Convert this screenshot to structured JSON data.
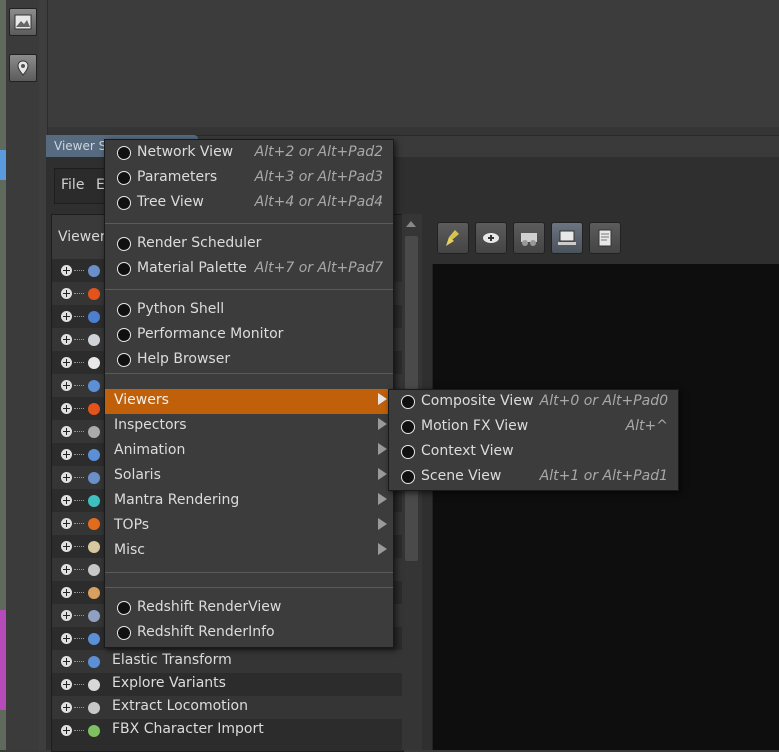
{
  "pane": {
    "tab_label": "Viewer St"
  },
  "menubar": {
    "file": "File",
    "edit": "E"
  },
  "tree": {
    "header": "Viewer",
    "items": [
      {
        "label": "",
        "icon": "toolbox-icon"
      },
      {
        "label": "",
        "icon": "houdini-swirl-icon"
      },
      {
        "label": "",
        "icon": "figure-icon"
      },
      {
        "label": "",
        "icon": "animals-icon"
      },
      {
        "label": "",
        "icon": "plane-icon"
      },
      {
        "label": "",
        "icon": "python-icon"
      },
      {
        "label": "",
        "icon": "houdini-swirl-icon"
      },
      {
        "label": "",
        "icon": "crowd-icon"
      },
      {
        "label": "",
        "icon": "python-icon"
      },
      {
        "label": "",
        "icon": "runner-icon"
      },
      {
        "label": "",
        "icon": "horseshoe-icon"
      },
      {
        "label": "",
        "icon": "explosion-icon"
      },
      {
        "label": "",
        "icon": "layer-icon"
      },
      {
        "label": "",
        "icon": "sphere-icon"
      },
      {
        "label": "",
        "icon": "box-icon"
      },
      {
        "label": "",
        "icon": "vehicle-icon"
      },
      {
        "label": "",
        "icon": "python-icon"
      },
      {
        "label": "Elastic Transform",
        "icon": "python-icon"
      },
      {
        "label": "Explore Variants",
        "icon": "variants-icon"
      },
      {
        "label": "Extract Locomotion",
        "icon": "walker-icon"
      },
      {
        "label": "FBX Character Import",
        "icon": "character-icon"
      }
    ]
  },
  "main_menu": {
    "items": [
      {
        "label": "Network View",
        "shortcut": "Alt+2 or Alt+Pad2"
      },
      {
        "label": "Parameters",
        "shortcut": "Alt+3 or Alt+Pad3"
      },
      {
        "label": "Tree View",
        "shortcut": "Alt+4 or Alt+Pad4"
      },
      {
        "label": "Render Scheduler",
        "shortcut": ""
      },
      {
        "label": "Material Palette",
        "shortcut": "Alt+7 or Alt+Pad7"
      },
      {
        "label": "Python Shell",
        "shortcut": ""
      },
      {
        "label": "Performance Monitor",
        "shortcut": ""
      },
      {
        "label": "Help Browser",
        "shortcut": ""
      }
    ],
    "submenus": [
      "Viewers",
      "Inspectors",
      "Animation",
      "Solaris",
      "Mantra Rendering",
      "TOPs",
      "Misc"
    ],
    "extra": [
      {
        "label": "Redshift RenderView"
      },
      {
        "label": "Redshift RenderInfo"
      }
    ]
  },
  "sub_menu": {
    "items": [
      {
        "label": "Composite View",
        "shortcut": "Alt+0 or Alt+Pad0"
      },
      {
        "label": "Motion FX View",
        "shortcut": "Alt+^"
      },
      {
        "label": "Context View",
        "shortcut": ""
      },
      {
        "label": "Scene View",
        "shortcut": "Alt+1 or Alt+Pad1"
      }
    ]
  },
  "colors": {
    "highlight": "#c0600a",
    "pane_tab": "#566a80",
    "menu_bg": "#3c3c3c"
  }
}
